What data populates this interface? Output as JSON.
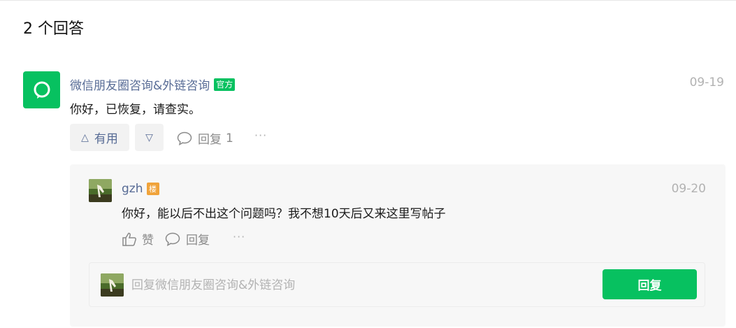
{
  "answers_header": "2 个回答",
  "answer": {
    "author": "微信朋友圈咨询&外链咨询",
    "badge": "官方",
    "date": "09-19",
    "content": "你好，已恢复，请查实。",
    "actions": {
      "useful_label": "有用",
      "reply_label": "回复",
      "reply_count": "1",
      "more": "···"
    },
    "avatar_icon": "wechat-logo-icon",
    "brand_color": "#07c160"
  },
  "sub_reply": {
    "author": "gzh",
    "floor_badge": "楼",
    "date": "09-20",
    "content": "你好，能以后不出这个问题吗？我不想10天后又来这里写帖子",
    "actions": {
      "like_label": "赞",
      "reply_label": "回复",
      "more": "···"
    }
  },
  "reply_box": {
    "placeholder": "回复微信朋友圈咨询&外链咨询",
    "submit_label": "回复"
  }
}
